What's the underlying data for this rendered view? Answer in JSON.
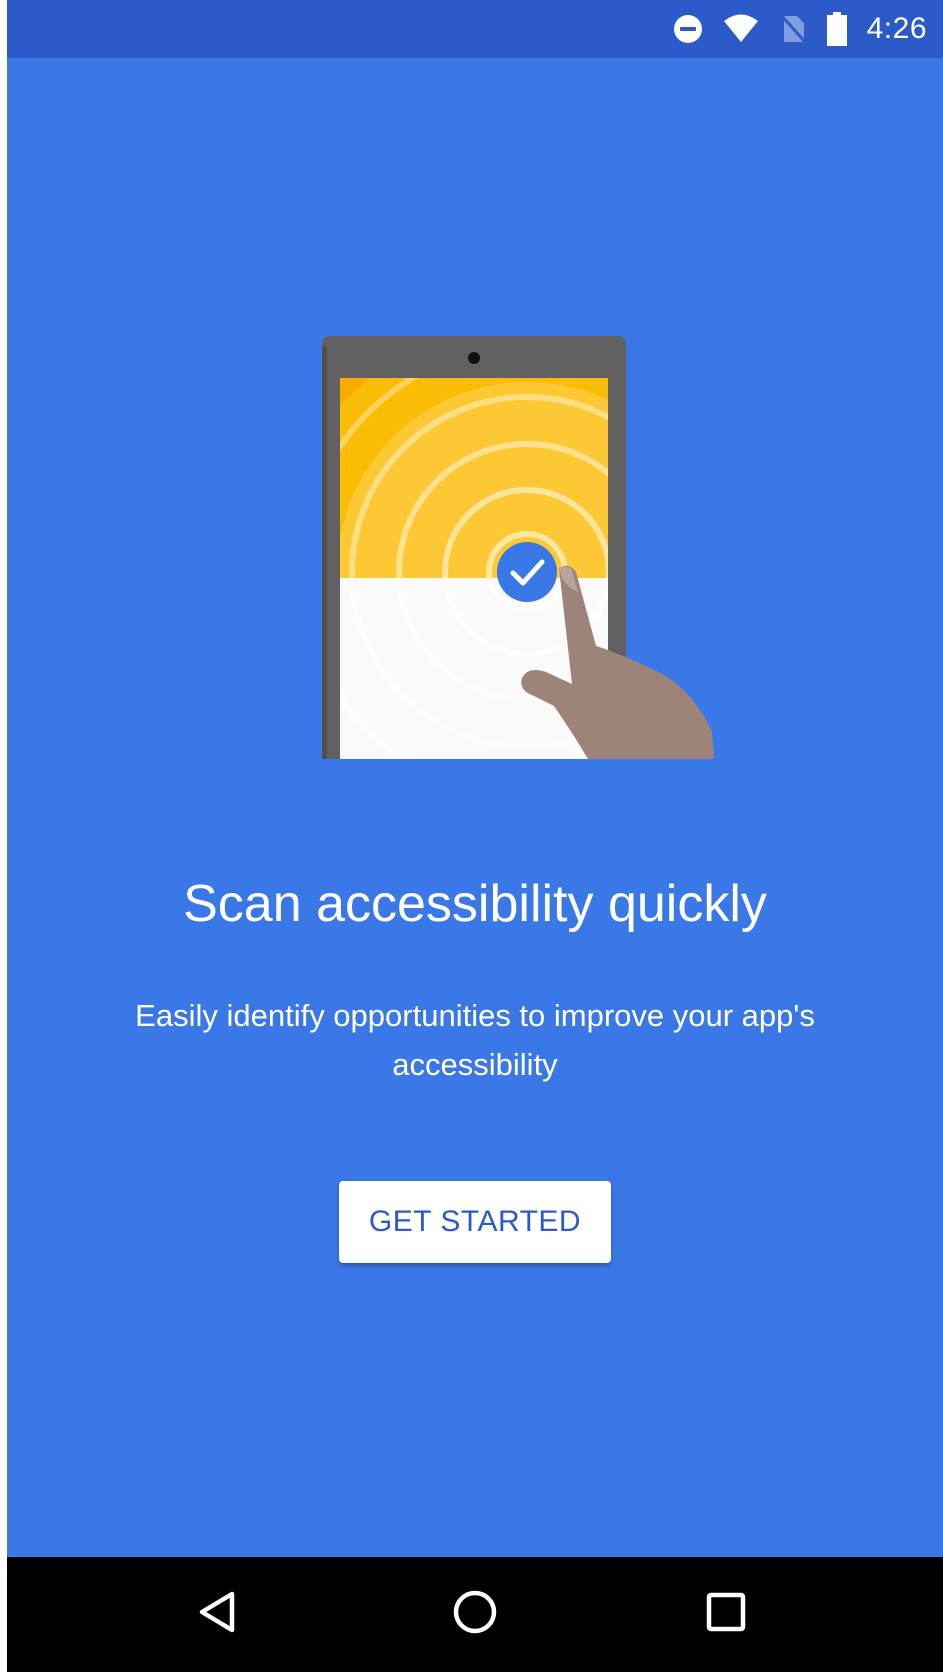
{
  "status_bar": {
    "time": "4:26",
    "icons": [
      "do-not-disturb-icon",
      "wifi-icon",
      "no-sim-icon",
      "battery-icon"
    ]
  },
  "onboarding": {
    "title": "Scan accessibility quickly",
    "subtitle": "Easily identify opportunities to improve your app's accessibility",
    "cta_label": "GET STARTED"
  },
  "illustration": {
    "icon": "tablet-tap-check-illustration"
  },
  "nav_bar": {
    "buttons": [
      "back-icon",
      "home-icon",
      "recents-icon"
    ]
  },
  "colors": {
    "background": "#3b78e7",
    "status_bar": "#2c5ac8",
    "button_text": "#2a5bc7",
    "illustration_yellow": "#fbbc05",
    "check_badge": "#3b78e7"
  }
}
